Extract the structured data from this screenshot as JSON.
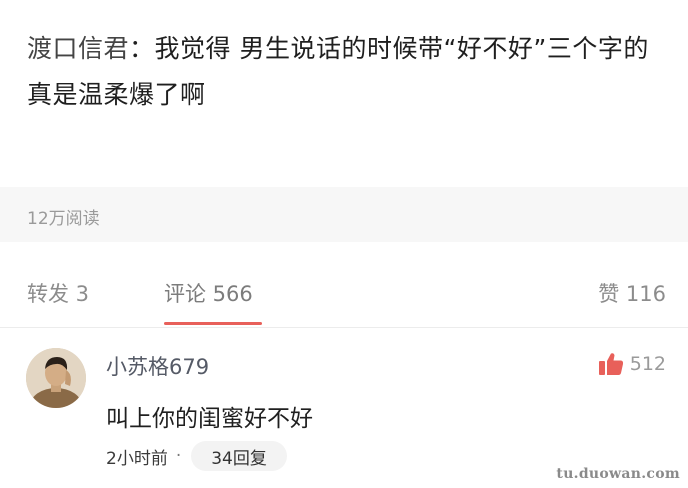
{
  "post": {
    "author": "渡口信君",
    "separator": "：",
    "text": "我觉得 男生说话的时候带“好不好”三个字的 真是温柔爆了啊",
    "reads": "12万阅读"
  },
  "tabs": {
    "repost": "转发 3",
    "comment": "评论 566",
    "like": "赞 116"
  },
  "comment": {
    "username": "小苏格679",
    "text": "叫上你的闺蜜好不好",
    "time": "2小时前",
    "dot": "·",
    "replies": "34回复",
    "likes": "512",
    "like_icon": "thumbs-up-icon",
    "like_color": "#e8605a"
  },
  "watermark": "tu.duowan.com"
}
